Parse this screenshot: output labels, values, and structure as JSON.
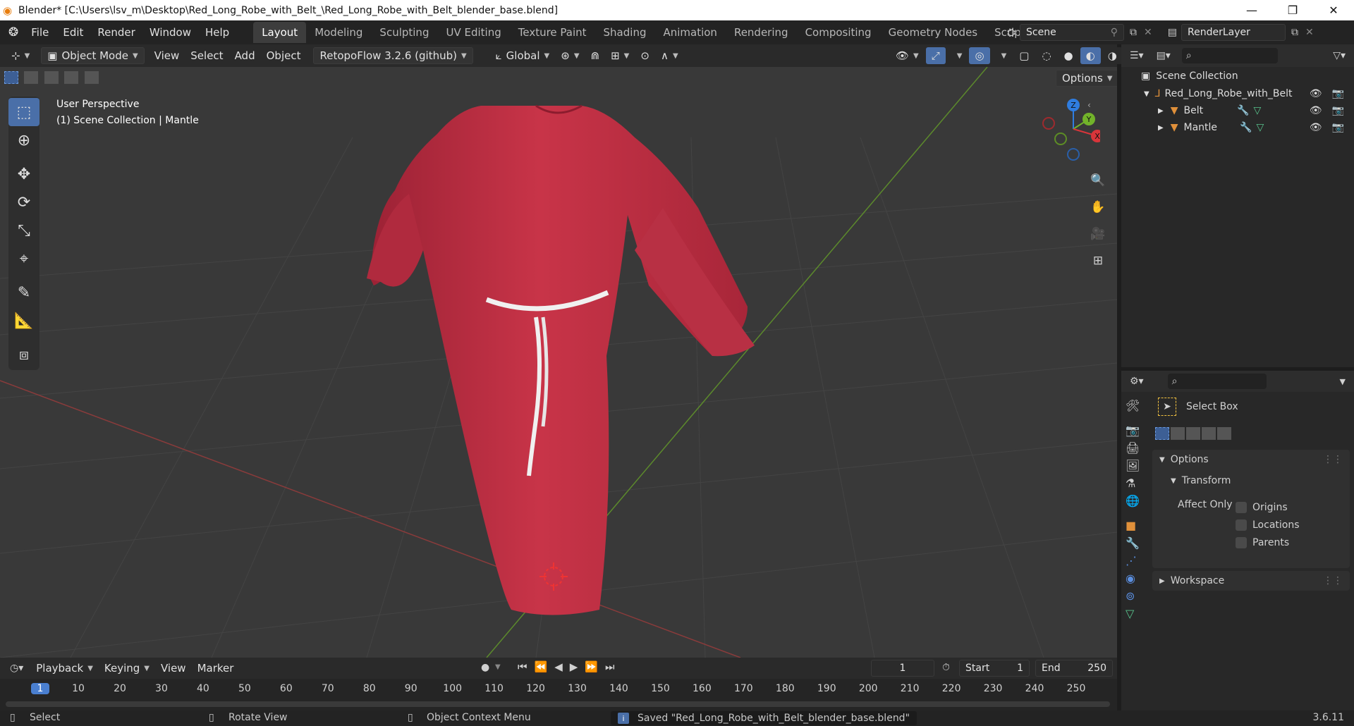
{
  "window": {
    "title": "Blender* [C:\\Users\\lsv_m\\Desktop\\Red_Long_Robe_with_Belt_\\Red_Long_Robe_with_Belt_blender_base.blend]"
  },
  "menu": [
    "File",
    "Edit",
    "Render",
    "Window",
    "Help"
  ],
  "workspaces": [
    "Layout",
    "Modeling",
    "Sculpting",
    "UV Editing",
    "Texture Paint",
    "Shading",
    "Animation",
    "Rendering",
    "Compositing",
    "Geometry Nodes",
    "Scripting"
  ],
  "active_workspace": "Layout",
  "scene_name": "Scene",
  "view_layer": "RenderLayer",
  "header": {
    "mode": "Object Mode",
    "view": "View",
    "select": "Select",
    "add": "Add",
    "object": "Object",
    "addon": "RetopoFlow 3.2.6 (github)",
    "orientation": "Global",
    "options": "Options"
  },
  "viewport": {
    "perspective": "User Perspective",
    "collection_info": "(1) Scene Collection | Mantle"
  },
  "gizmo": {
    "x": "X",
    "y": "Y",
    "z": "Z"
  },
  "outliner": {
    "root": "Scene Collection",
    "items": [
      {
        "name": "Red_Long_Robe_with_Belt",
        "level": 1
      },
      {
        "name": "Belt",
        "level": 2
      },
      {
        "name": "Mantle",
        "level": 2
      }
    ]
  },
  "properties": {
    "tool_name": "Select Box",
    "options_label": "Options",
    "transform_label": "Transform",
    "affect_only": "Affect Only",
    "checkboxes": [
      "Origins",
      "Locations",
      "Parents"
    ],
    "workspace_label": "Workspace"
  },
  "timeline": {
    "playback": "Playback",
    "keying": "Keying",
    "view": "View",
    "marker": "Marker",
    "current_frame": "1",
    "start_label": "Start",
    "start": "1",
    "end_label": "End",
    "end": "250",
    "ticks": [
      "1",
      "10",
      "20",
      "30",
      "40",
      "50",
      "60",
      "70",
      "80",
      "90",
      "100",
      "110",
      "120",
      "130",
      "140",
      "150",
      "160",
      "170",
      "180",
      "190",
      "200",
      "210",
      "220",
      "230",
      "240",
      "250"
    ]
  },
  "status": {
    "select": "Select",
    "rotate": "Rotate View",
    "context": "Object Context Menu",
    "message": "Saved \"Red_Long_Robe_with_Belt_blender_base.blend\"",
    "version": "3.6.11"
  }
}
